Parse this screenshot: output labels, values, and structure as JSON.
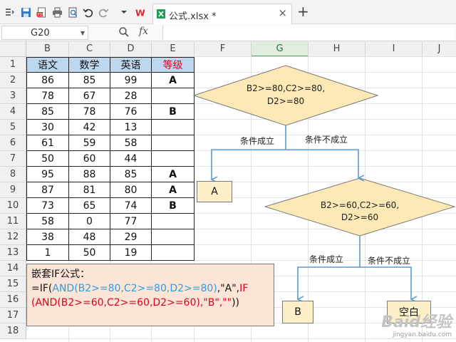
{
  "toolbar": {
    "tab_title": "公式.xlsx *",
    "tab_close": "×",
    "new_tab": "+"
  },
  "formula_bar": {
    "name_box": "G20",
    "fx_label": "fx",
    "formula": ""
  },
  "columns": [
    "B",
    "C",
    "D",
    "E",
    "F",
    "G",
    "H",
    "I",
    "J"
  ],
  "selected_column": "G",
  "rows": [
    "1",
    "2",
    "3",
    "4",
    "5",
    "6",
    "7",
    "8",
    "9",
    "10",
    "11",
    "12",
    "13",
    "14",
    "15",
    "16",
    "17",
    "18"
  ],
  "table": {
    "headers": [
      "语文",
      "数学",
      "英语",
      "等级"
    ],
    "data": [
      [
        "86",
        "85",
        "99",
        "A"
      ],
      [
        "78",
        "67",
        "28",
        ""
      ],
      [
        "85",
        "78",
        "76",
        "B"
      ],
      [
        "30",
        "42",
        "13",
        ""
      ],
      [
        "61",
        "59",
        "58",
        ""
      ],
      [
        "50",
        "60",
        "44",
        ""
      ],
      [
        "95",
        "88",
        "85",
        "A"
      ],
      [
        "87",
        "81",
        "80",
        "A"
      ],
      [
        "73",
        "65",
        "74",
        "B"
      ],
      [
        "58",
        "0",
        "77",
        ""
      ],
      [
        "38",
        "48",
        "29",
        ""
      ],
      [
        "1",
        "50",
        "19",
        ""
      ]
    ]
  },
  "diagram": {
    "decision1_line1": "B2>=80,C2>=80,",
    "decision1_line2": "D2>=80",
    "decision2_line1": "B2>=60,C2>=60,",
    "decision2_line2": "D2>=60",
    "yes1": "条件成立",
    "no1": "条件不成立",
    "yes2": "条件成立",
    "no2": "条件不成立",
    "result_a": "A",
    "result_b": "B",
    "result_blank": "空白"
  },
  "note": {
    "title": "嵌套IF公式：",
    "p1": "=IF(",
    "p2": "AND(B2>=80,C2>=80,D2>=80)",
    "p3": ",\"A\",",
    "p4": "IF",
    "p5": "(AND(B2>=60,C2>=60,D2>=60),",
    "p6": "\"B\",\"\"",
    "p7": "))"
  },
  "watermark": {
    "line1": "Baid经验",
    "line2": "jingyan.baidu.com"
  },
  "colors": {
    "header_fill": "#bdd7ee",
    "decision_fill": "#fde9b6",
    "box_fill": "#fdf0c8",
    "note_fill": "#fce4d6",
    "arrow": "#5b9bd5",
    "grade_header": "#e0001b",
    "formula_blue": "#2b9fe0",
    "formula_red": "#e0001b"
  }
}
